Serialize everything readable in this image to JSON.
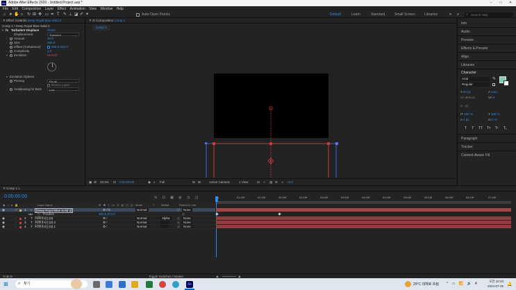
{
  "app": {
    "title": "Adobe After Effects 2020 - Untitled Project.aep *",
    "icon_label": "Ae"
  },
  "menu": [
    "File",
    "Edit",
    "Composition",
    "Layer",
    "Effect",
    "Animation",
    "View",
    "Window",
    "Help"
  ],
  "toolbar": {
    "auto_open_label": "Auto-Open Panels",
    "workspaces": [
      "Default",
      "Learn",
      "Standard",
      "Small Screen",
      "Libraries"
    ],
    "search_placeholder": "Search Help"
  },
  "effect_controls": {
    "tab_label": "Effect Controls",
    "tab_layer": "Deep Royal Blue Solid 2",
    "breadcrumb": "Comp 1 • Deep Royal Blue Solid 2",
    "effect_name": "Turbulent Displace",
    "reset_label": "Reset",
    "props": [
      {
        "name": "Displacement",
        "value": "Turbulent",
        "kind": "dropdown"
      },
      {
        "name": "Amount",
        "value": "40.0",
        "kind": "value"
      },
      {
        "name": "Size",
        "value": "200.0",
        "kind": "value"
      },
      {
        "name": "Offset (Turbulence)",
        "value": "960.0,540.0",
        "kind": "value"
      },
      {
        "name": "Complexity",
        "value": "1.0",
        "kind": "value"
      },
      {
        "name": "Evolution",
        "value": "0x+0.0°",
        "kind": "value"
      }
    ],
    "evolution_options": "Evolution Options",
    "pinning_label": "Pinning",
    "pinning_value": "Pin All",
    "resize_layer": "Resize Layer",
    "antialias_label": "Antialiasing for Best",
    "antialias_value": "Low"
  },
  "composition": {
    "tab_prefix": "Composition",
    "tab_name": "Comp 1",
    "sub_tab": "Comp 1",
    "zoom": "33.3%",
    "timecode": "0:00:00:00",
    "resolution": "Full",
    "camera": "Active Camera",
    "views": "1 View",
    "exposure": "+0.0"
  },
  "right_panel": {
    "items": [
      "Info",
      "Audio",
      "Preview",
      "Effects & Presets",
      "Align",
      "Libraries"
    ],
    "character_title": "Character",
    "font_family": "Arial",
    "font_style": "Regular",
    "font_size": "80 px",
    "leading": "Auto",
    "tracking_label": "Metrics",
    "tracking_value": "0",
    "stroke_width": "- px",
    "vscale": "100 %",
    "hscale": "100 %",
    "baseline": "0 px",
    "tsume": "0 %",
    "style_buttons": [
      "T",
      "T",
      "TT",
      "Tт",
      "T¹",
      "T₁"
    ],
    "bottom_items": [
      "Paragraph",
      "Tracker",
      "Content-Aware Fill"
    ]
  },
  "timeline": {
    "tab_label": "Comp 1",
    "timecode": "0:00:00:00",
    "col_headers": [
      "Layer Name",
      "Mode",
      "T",
      "TrkMat",
      "Parent & Link"
    ],
    "ruler": [
      "0s",
      "01:00f",
      "01:15f",
      "02:00f",
      "02:15f",
      "03:00f",
      "03:15f",
      "04:00f",
      "04:15f",
      "05:00f",
      "05:15f",
      "06:00f",
      "06:15f",
      "07:00f"
    ],
    "layers": [
      {
        "num": "1",
        "name": "[Deep Royal Blue Solid 2]",
        "mode": "Normal",
        "trkmat": "",
        "parent": "None",
        "color": "#c8b74a",
        "selected": true
      },
      {
        "num": "",
        "name": "Position",
        "mode": "",
        "trkmat": "",
        "parent": "",
        "value": "960.0,874.0",
        "color": "",
        "selected": false,
        "sub": true
      },
      {
        "num": "2",
        "name": "커피마시는(3)",
        "mode": "Normal",
        "trkmat": "Alpha",
        "parent": "None",
        "color": "#c34545",
        "selected": false
      },
      {
        "num": "3",
        "name": "커피마시는(2) 2",
        "mode": "Normal",
        "trkmat": "",
        "parent": "None",
        "color": "#c34545",
        "selected": false
      },
      {
        "num": "4",
        "name": "커피마시는(3) 1",
        "mode": "Normal",
        "trkmat": "",
        "parent": "None",
        "color": "#c34545",
        "selected": false
      }
    ],
    "bottom_label": "Toggle Switches / Modes"
  },
  "taskbar": {
    "search_placeholder": "찾기",
    "weather": "29°C 대체로 흐림",
    "time": "오전 10:43",
    "date": "2024-07-25"
  },
  "colors": {
    "accent": "#2d8ceb",
    "layer_bar": "#8e3e3e",
    "guide_red": "#c83a3a",
    "guide_blue": "#5570ff"
  }
}
